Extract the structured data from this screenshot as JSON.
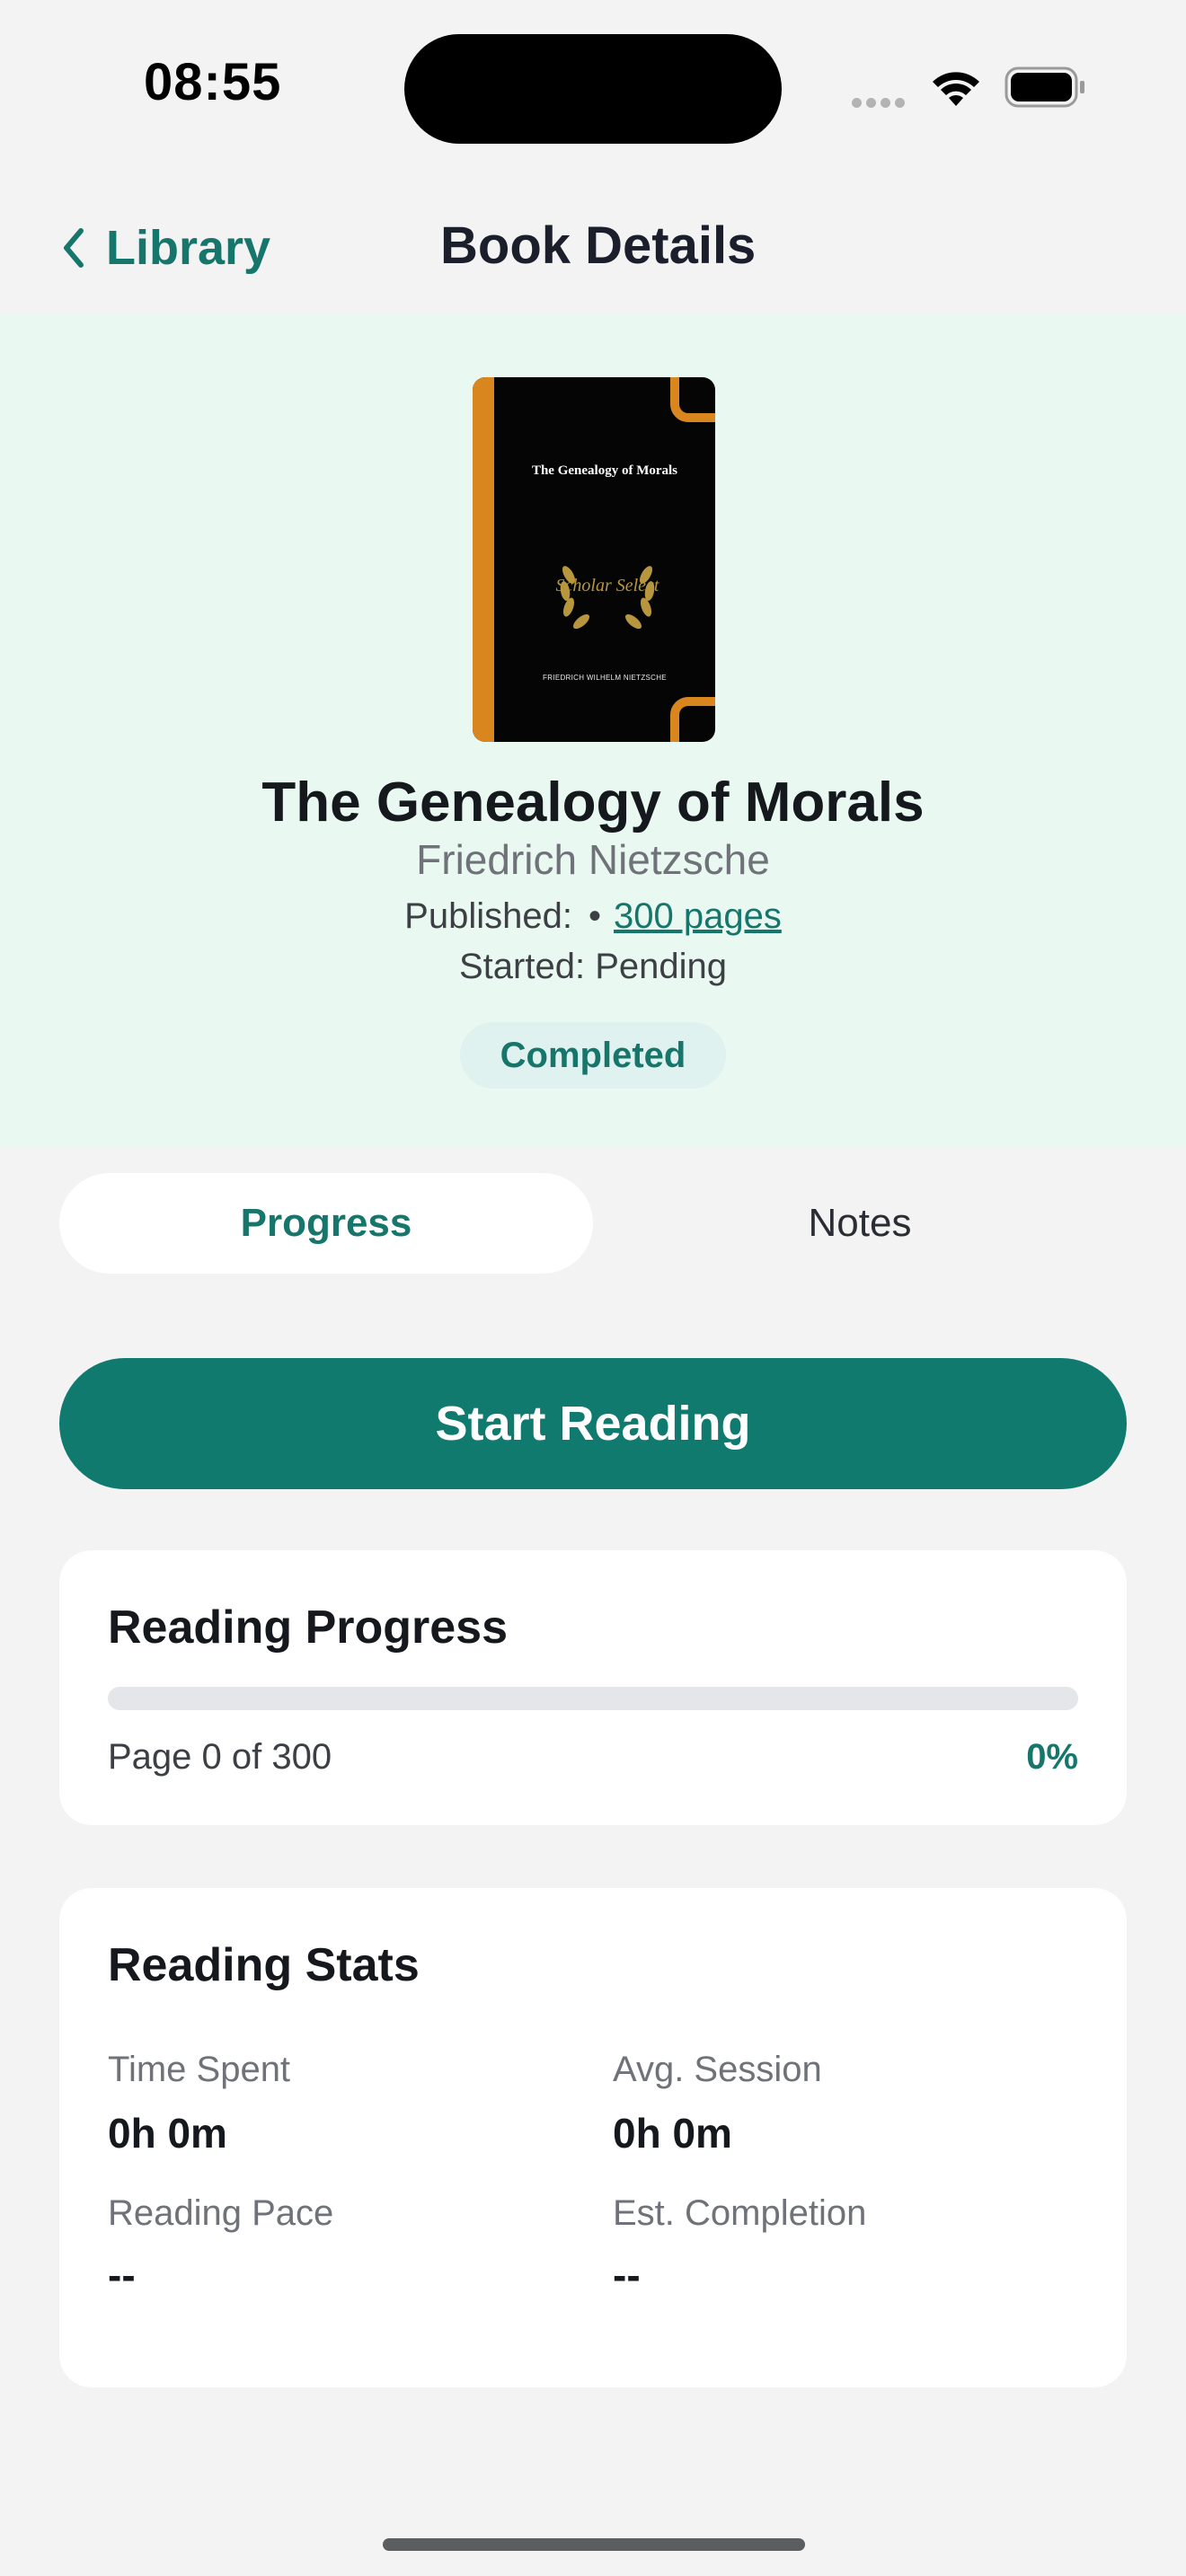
{
  "status_bar": {
    "time": "08:55"
  },
  "nav": {
    "back_label": "Library",
    "title": "Book Details"
  },
  "book": {
    "cover": {
      "title": "The Genealogy of Morals",
      "publisher_mark": "Scholar Select",
      "author": "FRIEDRICH WILHELM NIETZSCHE"
    },
    "title": "The Genealogy of Morals",
    "author": "Friedrich Nietzsche",
    "published_label": "Published:",
    "separator": "•",
    "pages_link": "300 pages",
    "started_text": "Started: Pending",
    "status_badge": "Completed"
  },
  "tabs": [
    {
      "label": "Progress",
      "active": true
    },
    {
      "label": "Notes",
      "active": false
    }
  ],
  "start_button": "Start Reading",
  "reading_progress": {
    "title": "Reading Progress",
    "page_text": "Page 0 of 300",
    "percent_text": "0%",
    "progress_fraction": 0
  },
  "reading_stats": {
    "title": "Reading Stats",
    "items": [
      {
        "label": "Time Spent",
        "value": "0h 0m"
      },
      {
        "label": "Avg. Session",
        "value": "0h 0m"
      },
      {
        "label": "Reading Pace",
        "value": "--"
      },
      {
        "label": "Est. Completion",
        "value": "--"
      }
    ]
  },
  "colors": {
    "accent": "#107a6f",
    "hero_bg": "#e9f9f1",
    "page_bg": "#f3f3f4",
    "badge_bg": "#dff2ef"
  }
}
